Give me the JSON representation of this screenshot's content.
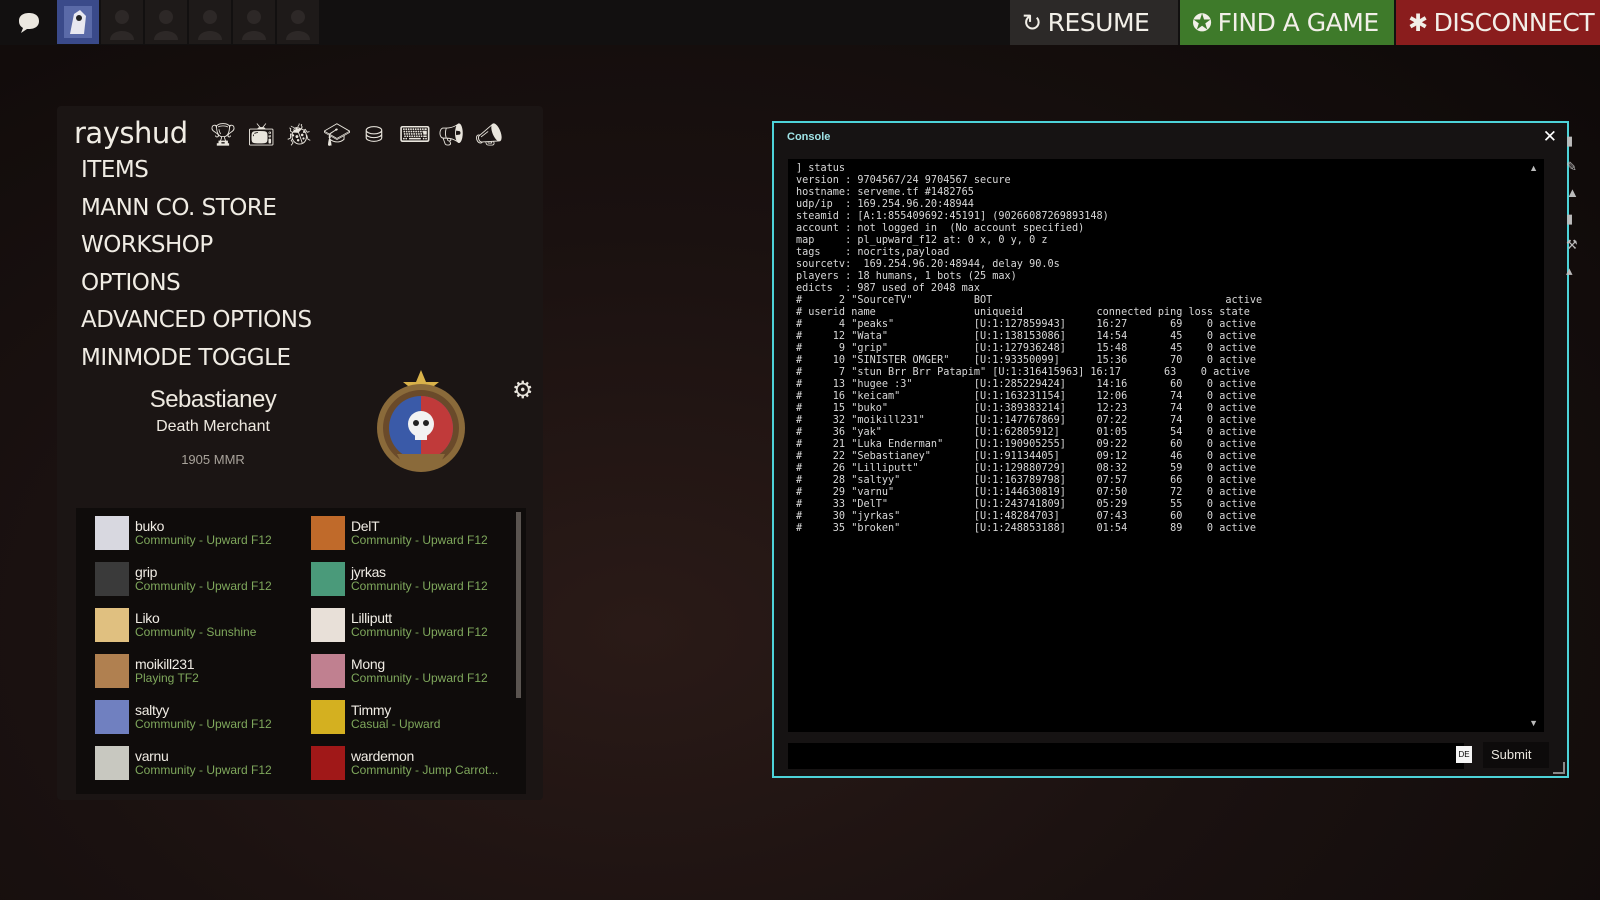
{
  "colors": {
    "resume_bg": "#2c2928",
    "find_bg": "#3e7a2a",
    "disconnect_bg": "#8a1d1d",
    "console_border": "#4dd3d9",
    "friend_status": "#7fa85c"
  },
  "topbar": {
    "resume_label": "RESUME",
    "find_label": "FIND A GAME",
    "disconnect_label": "DISCONNECT",
    "icons": [
      "chat-icon",
      "resume-icon",
      "find-game-icon",
      "disconnect-icon"
    ]
  },
  "panel": {
    "brand": "rayshud",
    "tool_icons": [
      "trophy-icon",
      "tv-icon",
      "bug-icon",
      "graduation-cap-icon",
      "database-add-icon",
      "terminal-icon",
      "megaphone-icon",
      "bullhorn-icon"
    ],
    "menu": [
      "ITEMS",
      "MANN CO. STORE",
      "WORKSHOP",
      "OPTIONS",
      "ADVANCED OPTIONS",
      "MINMODE TOGGLE"
    ],
    "profile": {
      "name": "Sebastianey",
      "title": "Death Merchant",
      "mmr": "1905 MMR"
    }
  },
  "friends": [
    {
      "name": "buko",
      "status": "Community - Upward F12",
      "color": "#d8d8e0"
    },
    {
      "name": "DelT",
      "status": "Community - Upward F12",
      "color": "#c06a2a"
    },
    {
      "name": "grip",
      "status": "Community - Upward F12",
      "color": "#3a3a3a"
    },
    {
      "name": "jyrkas",
      "status": "Community - Upward F12",
      "color": "#4a9a7a"
    },
    {
      "name": "Liko",
      "status": "Community - Sunshine",
      "color": "#e0c080"
    },
    {
      "name": "Lilliputt",
      "status": "Community - Upward F12",
      "color": "#e8e0d8"
    },
    {
      "name": "moikill231",
      "status": "Playing TF2",
      "color": "#b08050"
    },
    {
      "name": "Mong",
      "status": "Community - Upward F12",
      "color": "#c08090"
    },
    {
      "name": "saltyy",
      "status": "Community - Upward F12",
      "color": "#7080c0"
    },
    {
      "name": "Timmy",
      "status": "Casual - Upward",
      "color": "#d4b020"
    },
    {
      "name": "varnu",
      "status": "Community - Upward F12",
      "color": "#c8c8c0"
    },
    {
      "name": "wardemon",
      "status": "Community - Jump Carrot...",
      "color": "#a01818"
    }
  ],
  "console": {
    "title": "Console",
    "close_label": "✕",
    "input_value": "",
    "lang": "DE",
    "submit_label": "Submit",
    "lines": [
      "] status",
      "version : 9704567/24 9704567 secure",
      "hostname: serveme.tf #1482765",
      "udp/ip  : 169.254.96.20:48944",
      "steamid : [A:1:855409692:45191] (90266087269893148)",
      "account : not logged in  (No account specified)",
      "map     : pl_upward_f12 at: 0 x, 0 y, 0 z",
      "tags    : nocrits,payload",
      "sourcetv:  169.254.96.20:48944, delay 90.0s",
      "players : 18 humans, 1 bots (25 max)",
      "edicts  : 987 used of 2048 max",
      "#      2 \"SourceTV\"          BOT                                      active",
      "# userid name                uniqueid            connected ping loss state",
      "#      4 \"peaks\"             [U:1:127859943]     16:27       69    0 active",
      "#     12 \"Wata\"              [U:1:138153086]     14:54       45    0 active",
      "#      9 \"grip\"              [U:1:127936248]     15:48       45    0 active",
      "#     10 \"SINISTER OMGER\"    [U:1:93350099]      15:36       70    0 active",
      "#      7 \"stun Brr Brr Patapim\" [U:1:316415963] 16:17       63    0 active",
      "#     13 \"hugee :3\"          [U:1:285229424]     14:16       60    0 active",
      "#     16 \"keicam\"            [U:1:163231154]     12:06       74    0 active",
      "#     15 \"buko\"              [U:1:389383214]     12:23       74    0 active",
      "#     32 \"moikill231\"        [U:1:147767869]     07:22       74    0 active",
      "#     36 \"yak\"               [U:1:62805912]      01:05       54    0 active",
      "#     21 \"Luka Enderman\"     [U:1:190905255]     09:22       60    0 active",
      "#     22 \"Sebastianey\"       [U:1:91134405]      09:12       46    0 active",
      "#     26 \"Lilliputt\"         [U:1:129880729]     08:32       59    0 active",
      "#     28 \"saltyy\"            [U:1:163789798]     07:57       66    0 active",
      "#     29 \"varnu\"             [U:1:144630819]     07:50       72    0 active",
      "#     33 \"DelT\"              [U:1:243741809]     05:29       55    0 active",
      "#     30 \"jyrkas\"            [U:1:48284703]      07:43       60    0 active",
      "#     35 \"broken\"            [U:1:248853188]     01:54       89    0 active"
    ]
  }
}
